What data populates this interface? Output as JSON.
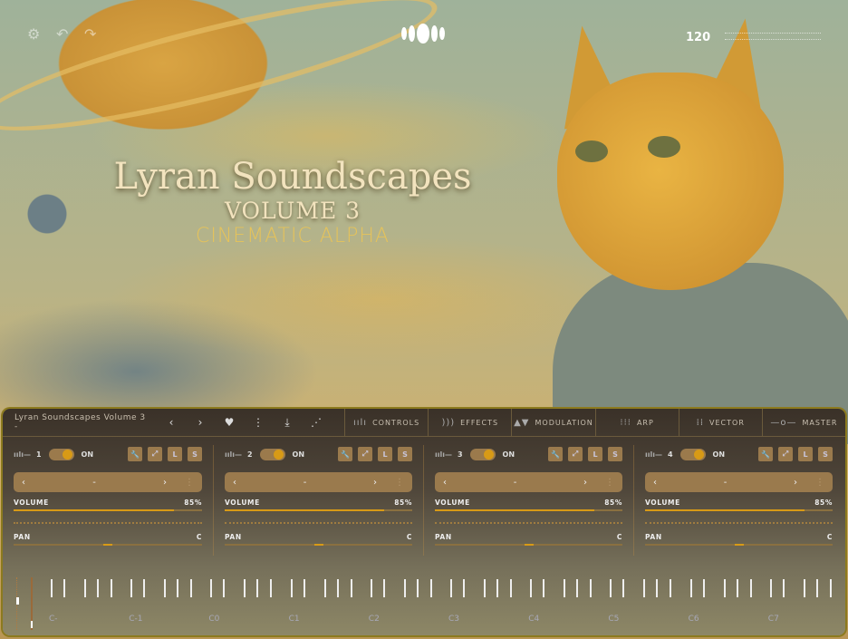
{
  "hero": {
    "title": "Lyran Soundscapes",
    "volume": "VOLUME 3",
    "subtitle": "CINEMATIC ALPHA"
  },
  "top": {
    "bpm": "120"
  },
  "header": {
    "preset_name": "Lyran Soundscapes Volume 3",
    "preset_sub": "-",
    "tabs": [
      {
        "label": "CONTROLS",
        "icon": "waveform-icon"
      },
      {
        "label": "EFFECTS",
        "icon": "sound-waves-icon"
      },
      {
        "label": "MODULATION",
        "icon": "modulation-icon"
      },
      {
        "label": "ARP",
        "icon": "arp-icon"
      },
      {
        "label": "VECTOR",
        "icon": "grid-icon"
      },
      {
        "label": "MASTER",
        "icon": "slider-icon"
      }
    ]
  },
  "channels": [
    {
      "num": "1",
      "state": "ON",
      "preset": "-",
      "volume_label": "VOLUME",
      "volume": "85%",
      "volume_value": 85,
      "pan_label": "PAN",
      "pan": "C",
      "l": "L",
      "s": "S"
    },
    {
      "num": "2",
      "state": "ON",
      "preset": "-",
      "volume_label": "VOLUME",
      "volume": "85%",
      "volume_value": 85,
      "pan_label": "PAN",
      "pan": "C",
      "l": "L",
      "s": "S"
    },
    {
      "num": "3",
      "state": "ON",
      "preset": "-",
      "volume_label": "VOLUME",
      "volume": "85%",
      "volume_value": 85,
      "pan_label": "PAN",
      "pan": "C",
      "l": "L",
      "s": "S"
    },
    {
      "num": "4",
      "state": "ON",
      "preset": "-",
      "volume_label": "VOLUME",
      "volume": "85%",
      "volume_value": 85,
      "pan_label": "PAN",
      "pan": "C",
      "l": "L",
      "s": "S"
    }
  ],
  "keyboard": {
    "octaves": [
      "C-",
      "C-1",
      "C0",
      "C1",
      "C2",
      "C3",
      "C4",
      "C5",
      "C6",
      "C7"
    ]
  },
  "colors": {
    "accent": "#d89a16",
    "control_bg": "#9a7a4d"
  }
}
